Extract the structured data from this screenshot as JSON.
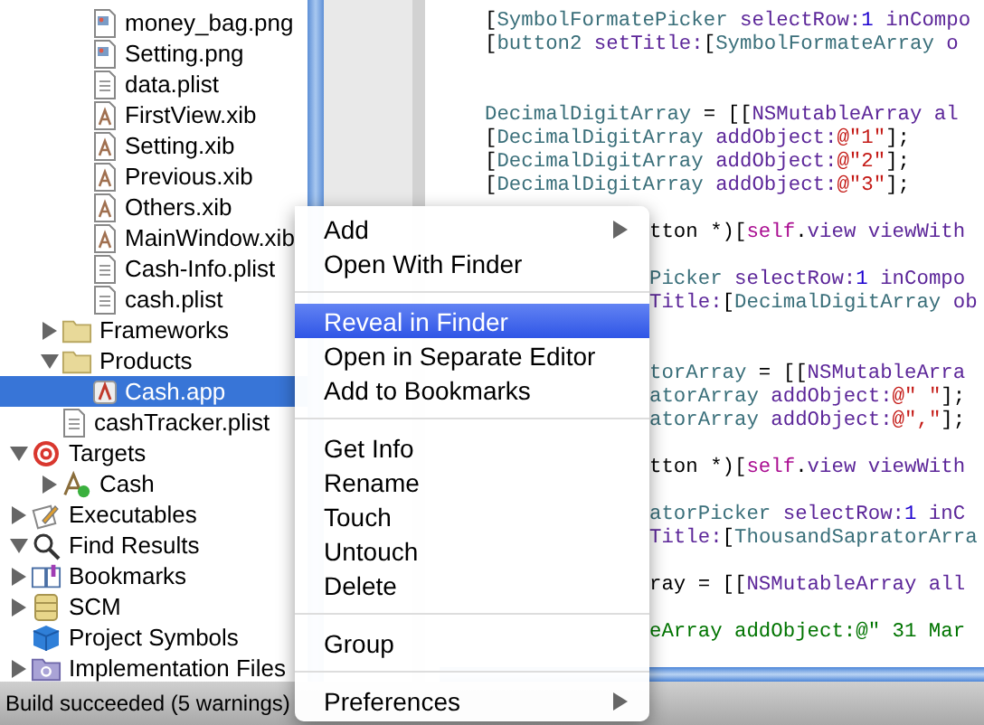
{
  "sidebar": {
    "tree": [
      {
        "children": [
          {
            "children": [
              {
                "label": "money_bag.png",
                "kind": "image-file",
                "selected": false
              },
              {
                "label": "Setting.png",
                "kind": "image-file",
                "selected": false
              },
              {
                "label": "data.plist",
                "kind": "text-file",
                "selected": false
              },
              {
                "label": "FirstView.xib",
                "kind": "xib-file",
                "selected": false
              },
              {
                "label": "Setting.xib",
                "kind": "xib-file",
                "selected": false
              },
              {
                "label": "Previous.xib",
                "kind": "xib-file",
                "selected": false
              },
              {
                "label": "Others.xib",
                "kind": "xib-file",
                "selected": false
              },
              {
                "label": "MainWindow.xib",
                "kind": "xib-file",
                "selected": false
              },
              {
                "label": "Cash-Info.plist",
                "kind": "text-file",
                "selected": false
              },
              {
                "label": "cash.plist",
                "kind": "text-file",
                "selected": false
              }
            ]
          },
          {
            "label": "Frameworks",
            "kind": "folder",
            "expanded": false,
            "selected": false
          },
          {
            "label": "Products",
            "kind": "folder",
            "expanded": true,
            "selected": false,
            "children": [
              {
                "label": "Cash.app",
                "kind": "app",
                "selected": true
              }
            ]
          },
          {
            "label": "cashTracker.plist",
            "kind": "text-file",
            "selected": false
          }
        ]
      },
      {
        "label": "Targets",
        "kind": "target",
        "expanded": true,
        "selected": false,
        "children": [
          {
            "label": "Cash",
            "kind": "app-target",
            "expanded": false,
            "selected": false
          }
        ]
      },
      {
        "label": "Executables",
        "kind": "executables",
        "expanded": false,
        "selected": false
      },
      {
        "label": "Find Results",
        "kind": "search",
        "expanded": true,
        "selected": false
      },
      {
        "label": "Bookmarks",
        "kind": "bookmarks",
        "expanded": false,
        "selected": false
      },
      {
        "label": "SCM",
        "kind": "scm",
        "expanded": false,
        "selected": false
      },
      {
        "label": "Project Symbols",
        "kind": "symbols",
        "selected": false
      },
      {
        "label": "Implementation Files",
        "kind": "smart-group",
        "expanded": false,
        "selected": false
      }
    ]
  },
  "editor": {
    "lines": [
      {
        "kind": "full",
        "tokens": [
          {
            "t": "[",
            "color": "#000000"
          },
          {
            "t": "SymbolFormatePicker",
            "color": "#3a6f7a"
          },
          {
            "t": " selectRow:",
            "color": "#5c2699"
          },
          {
            "t": "1",
            "color": "#1c00cf"
          },
          {
            "t": " inCompo",
            "color": "#5c2699"
          }
        ]
      },
      {
        "kind": "full",
        "tokens": [
          {
            "t": "[",
            "color": "#000000"
          },
          {
            "t": "button2",
            "color": "#3a6f7a"
          },
          {
            "t": " setTitle:",
            "color": "#5c2699"
          },
          {
            "t": "[",
            "color": "#000000"
          },
          {
            "t": "SymbolFormateArray",
            "color": "#3a6f7a"
          },
          {
            "t": " o",
            "color": "#5c2699"
          }
        ]
      },
      {
        "kind": "blank"
      },
      {
        "kind": "blank"
      },
      {
        "kind": "full",
        "tokens": [
          {
            "t": "DecimalDigitArray",
            "color": "#3a6f7a"
          },
          {
            "t": " = [[",
            "color": "#000000"
          },
          {
            "t": "NSMutableArray al",
            "color": "#5c2699"
          }
        ]
      },
      {
        "kind": "full",
        "tokens": [
          {
            "t": "[",
            "color": "#000000"
          },
          {
            "t": "DecimalDigitArray",
            "color": "#3a6f7a"
          },
          {
            "t": " addObject:",
            "color": "#5c2699"
          },
          {
            "t": "@\"1\"",
            "color": "#c41a16"
          },
          {
            "t": "];",
            "color": "#000000"
          }
        ]
      },
      {
        "kind": "full",
        "tokens": [
          {
            "t": "[",
            "color": "#000000"
          },
          {
            "t": "DecimalDigitArray",
            "color": "#3a6f7a"
          },
          {
            "t": " addObject:",
            "color": "#5c2699"
          },
          {
            "t": "@\"2\"",
            "color": "#c41a16"
          },
          {
            "t": "];",
            "color": "#000000"
          }
        ]
      },
      {
        "kind": "full",
        "tokens": [
          {
            "t": "[",
            "color": "#000000"
          },
          {
            "t": "DecimalDigitArray",
            "color": "#3a6f7a"
          },
          {
            "t": " addObject:",
            "color": "#5c2699"
          },
          {
            "t": "@\"3\"",
            "color": "#c41a16"
          },
          {
            "t": "];",
            "color": "#000000"
          }
        ]
      },
      {
        "kind": "blank"
      },
      {
        "kind": "tail",
        "tokens": [
          {
            "t": "tton *)[",
            "color": "#000000"
          },
          {
            "t": "self",
            "color": "#aa0d91"
          },
          {
            "t": ".",
            "color": "#000000"
          },
          {
            "t": "view viewWith",
            "color": "#5c2699"
          }
        ]
      },
      {
        "kind": "blank"
      },
      {
        "kind": "tail",
        "tokens": [
          {
            "t": "Picker",
            "color": "#3a6f7a"
          },
          {
            "t": " selectRow:",
            "color": "#5c2699"
          },
          {
            "t": "1",
            "color": "#1c00cf"
          },
          {
            "t": " inCompo",
            "color": "#5c2699"
          }
        ]
      },
      {
        "kind": "tail",
        "tokens": [
          {
            "t": "Title:",
            "color": "#5c2699"
          },
          {
            "t": "[",
            "color": "#000000"
          },
          {
            "t": "DecimalDigitArray",
            "color": "#3a6f7a"
          },
          {
            "t": " ob",
            "color": "#5c2699"
          }
        ]
      },
      {
        "kind": "blank"
      },
      {
        "kind": "blank"
      },
      {
        "kind": "tail",
        "tokens": [
          {
            "t": "torArray",
            "color": "#3a6f7a"
          },
          {
            "t": " = [[",
            "color": "#000000"
          },
          {
            "t": "NSMutableArra",
            "color": "#5c2699"
          }
        ]
      },
      {
        "kind": "tail",
        "tokens": [
          {
            "t": "atorArray",
            "color": "#3a6f7a"
          },
          {
            "t": " addObject:",
            "color": "#5c2699"
          },
          {
            "t": "@\" \"",
            "color": "#c41a16"
          },
          {
            "t": "];",
            "color": "#000000"
          }
        ]
      },
      {
        "kind": "tail",
        "tokens": [
          {
            "t": "atorArray",
            "color": "#3a6f7a"
          },
          {
            "t": " addObject:",
            "color": "#5c2699"
          },
          {
            "t": "@\",\"",
            "color": "#c41a16"
          },
          {
            "t": "];",
            "color": "#000000"
          }
        ]
      },
      {
        "kind": "blank"
      },
      {
        "kind": "tail",
        "tokens": [
          {
            "t": "tton *)[",
            "color": "#000000"
          },
          {
            "t": "self",
            "color": "#aa0d91"
          },
          {
            "t": ".",
            "color": "#000000"
          },
          {
            "t": "view viewWith",
            "color": "#5c2699"
          }
        ]
      },
      {
        "kind": "blank"
      },
      {
        "kind": "tail",
        "tokens": [
          {
            "t": "atorPicker",
            "color": "#3a6f7a"
          },
          {
            "t": " selectRow:",
            "color": "#5c2699"
          },
          {
            "t": "1",
            "color": "#1c00cf"
          },
          {
            "t": " inC",
            "color": "#5c2699"
          }
        ]
      },
      {
        "kind": "tail",
        "tokens": [
          {
            "t": "Title:",
            "color": "#5c2699"
          },
          {
            "t": "[",
            "color": "#000000"
          },
          {
            "t": "ThousandSapratorArra",
            "color": "#3a6f7a"
          }
        ]
      },
      {
        "kind": "blank"
      },
      {
        "kind": "tail",
        "tokens": [
          {
            "t": "ray = [[",
            "color": "#000000"
          },
          {
            "t": "NSMutableArray all",
            "color": "#5c2699"
          }
        ]
      },
      {
        "kind": "blank"
      },
      {
        "kind": "tail",
        "tokens": [
          {
            "t": "eArray addObject:@\" 31 Mar",
            "color": "#007400"
          }
        ]
      }
    ]
  },
  "context_menu": {
    "items": [
      {
        "kind": "item",
        "label": "Add",
        "submenu": true,
        "selected": false
      },
      {
        "kind": "item",
        "label": "Open With Finder",
        "submenu": false,
        "selected": false
      },
      {
        "kind": "separator"
      },
      {
        "kind": "item",
        "label": "Reveal in Finder",
        "submenu": false,
        "selected": true
      },
      {
        "kind": "item",
        "label": "Open in Separate Editor",
        "submenu": false,
        "selected": false
      },
      {
        "kind": "item",
        "label": "Add to Bookmarks",
        "submenu": false,
        "selected": false
      },
      {
        "kind": "separator"
      },
      {
        "kind": "item",
        "label": "Get Info",
        "submenu": false,
        "selected": false
      },
      {
        "kind": "item",
        "label": "Rename",
        "submenu": false,
        "selected": false
      },
      {
        "kind": "item",
        "label": "Touch",
        "submenu": false,
        "selected": false
      },
      {
        "kind": "item",
        "label": "Untouch",
        "submenu": false,
        "selected": false
      },
      {
        "kind": "item",
        "label": "Delete",
        "submenu": false,
        "selected": false
      },
      {
        "kind": "separator"
      },
      {
        "kind": "item",
        "label": "Group",
        "submenu": false,
        "selected": false
      },
      {
        "kind": "separator"
      },
      {
        "kind": "item",
        "label": "Preferences",
        "submenu": true,
        "selected": false
      }
    ]
  },
  "status_bar": {
    "text": "Build succeeded (5 warnings)"
  }
}
